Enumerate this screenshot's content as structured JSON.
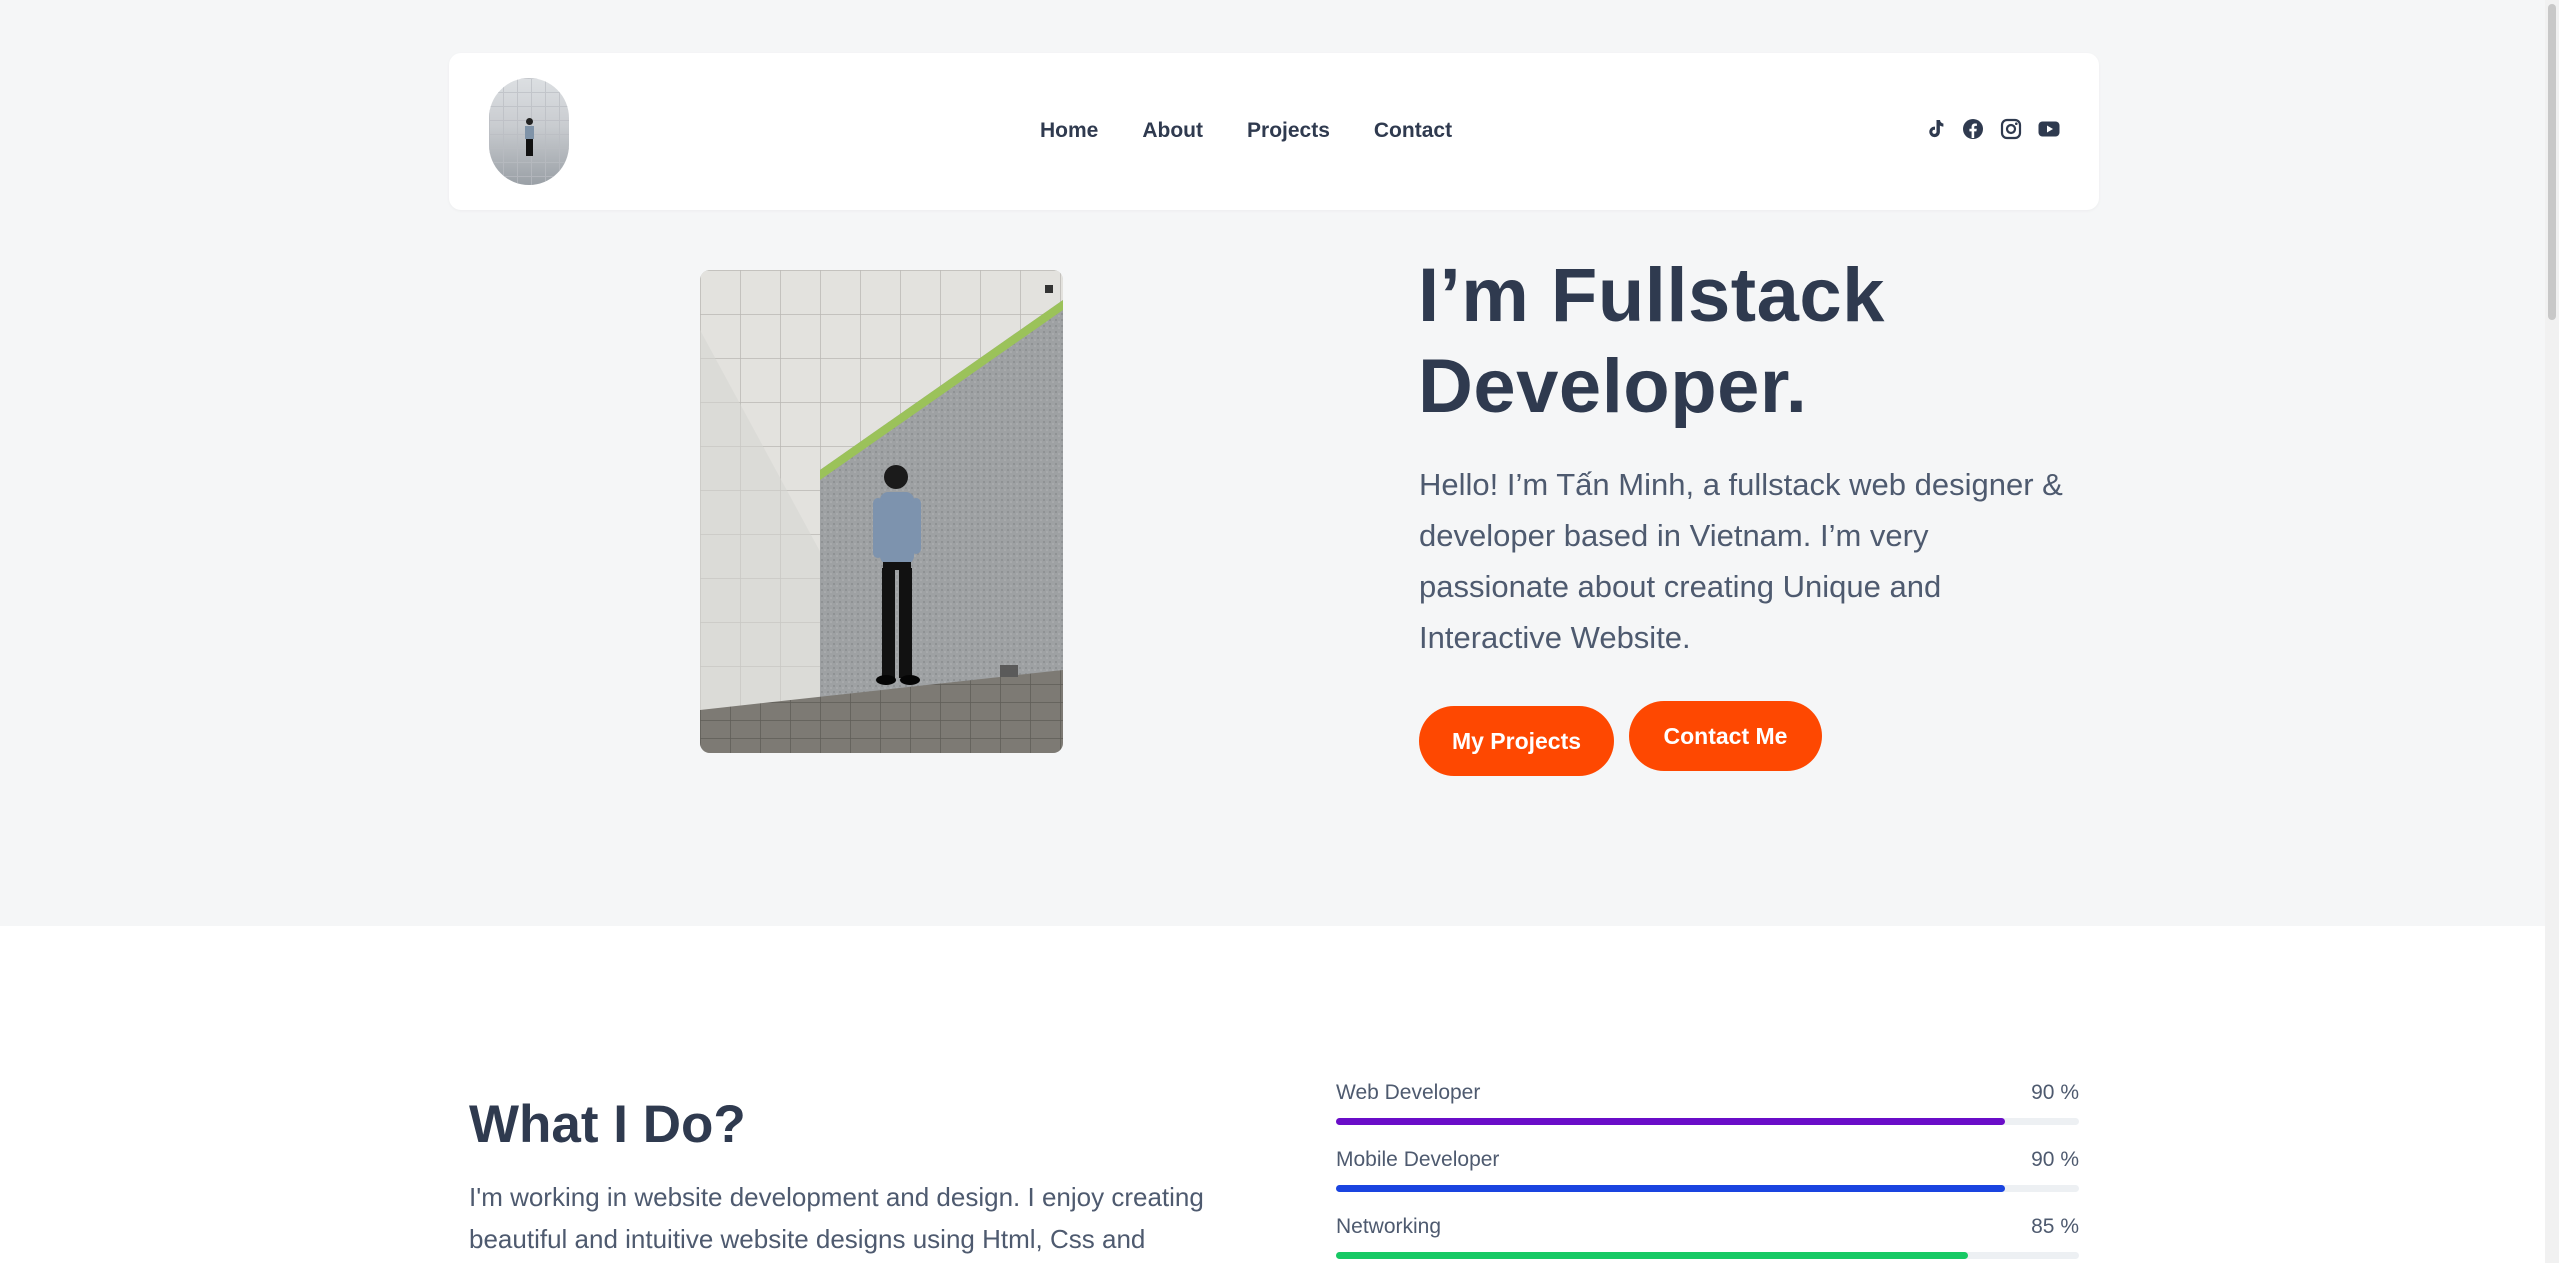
{
  "nav": {
    "items": [
      {
        "label": "Home"
      },
      {
        "label": "About"
      },
      {
        "label": "Projects"
      },
      {
        "label": "Contact"
      }
    ]
  },
  "socials": [
    "tiktok-icon",
    "facebook-icon",
    "instagram-icon",
    "youtube-icon"
  ],
  "hero": {
    "title_line1": "I’m Fullstack",
    "title_line2": "Developer.",
    "description": "Hello! I’m Tấn Minh, a fullstack web designer & developer based in Vietnam. I’m very passionate about creating Unique and Interactive Website.",
    "btn_projects": "My Projects",
    "btn_contact": "Contact Me"
  },
  "whatido": {
    "title": "What I Do?",
    "text": "I'm working in website development and design. I enjoy creating beautiful and intuitive website designs using Html, Css and"
  },
  "skills": [
    {
      "name": "Web Developer",
      "percent_label": "90 %",
      "percent": 90,
      "color": "#6a0dc8"
    },
    {
      "name": "Mobile Developer",
      "percent_label": "90 %",
      "percent": 90,
      "color": "#1a44e0"
    },
    {
      "name": "Networking",
      "percent_label": "85 %",
      "percent": 85,
      "color": "#17c964"
    }
  ],
  "colors": {
    "accent": "#fe4801",
    "text": "#2f3a4f",
    "background": "#f5f6f7"
  }
}
